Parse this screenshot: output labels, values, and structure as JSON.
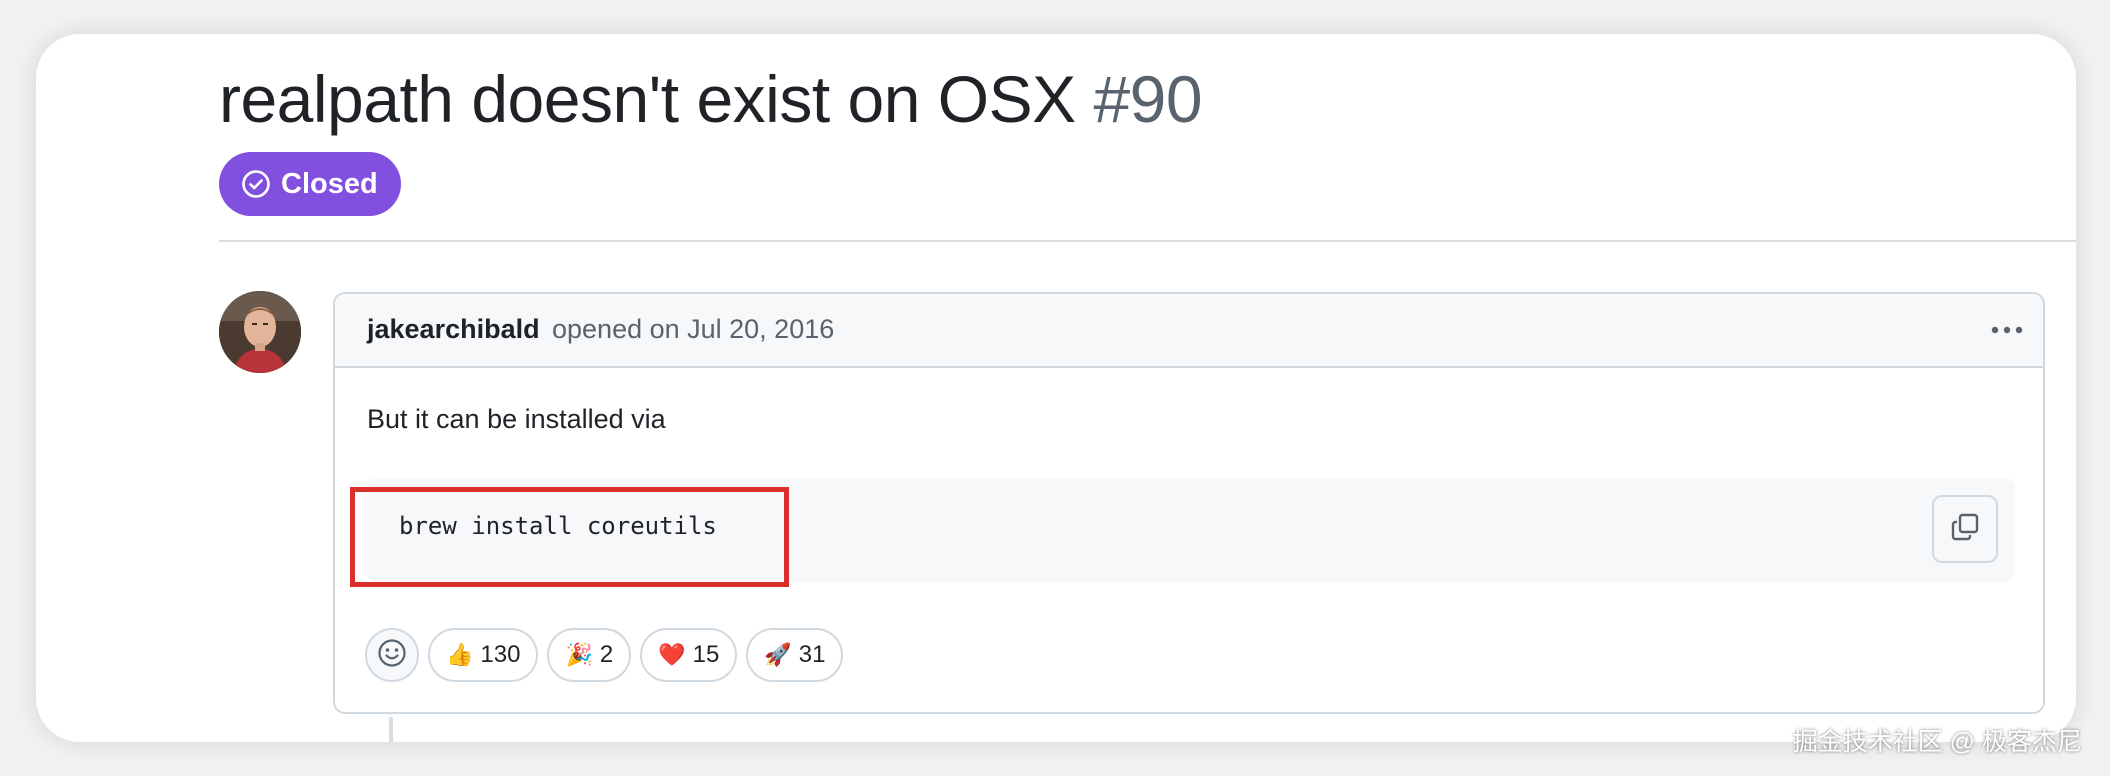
{
  "issue": {
    "title": "realpath doesn't exist on OSX",
    "number": "#90",
    "state": "Closed",
    "state_color": "#8250df",
    "state_icon": "check-circle-icon"
  },
  "comment": {
    "author": "jakearchibald",
    "meta": "opened on Jul 20, 2016",
    "body": "But it can be installed via",
    "code": "brew install coreutils",
    "highlight_color": "#d9302b",
    "menu_icon": "kebab-horizontal-icon",
    "copy_icon": "copy-icon"
  },
  "reactions": {
    "add_icon": "smiley-icon",
    "items": [
      {
        "emoji": "👍",
        "icon": "thumbs-up-icon",
        "count": "130"
      },
      {
        "emoji": "🎉",
        "icon": "party-popper-icon",
        "count": "2"
      },
      {
        "emoji": "❤️",
        "icon": "heart-icon",
        "count": "15"
      },
      {
        "emoji": "🚀",
        "icon": "rocket-icon",
        "count": "31"
      }
    ]
  },
  "watermark": "掘金技术社区 @ 极客杰尼"
}
